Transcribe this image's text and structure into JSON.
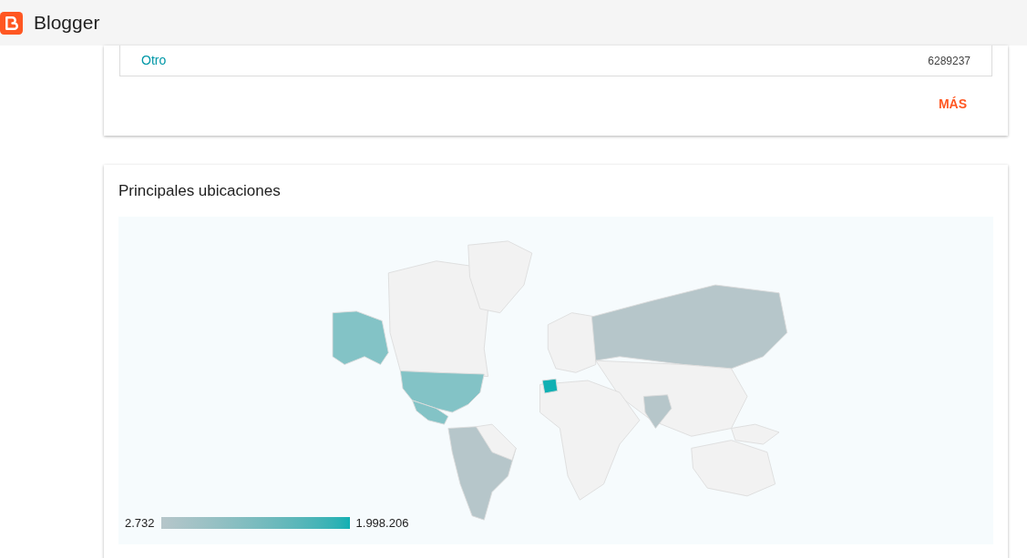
{
  "header": {
    "title": "Blogger"
  },
  "sources_card": {
    "rows": [
      {
        "label": "Otro",
        "count": "6289237"
      }
    ],
    "more_button": "MÁS"
  },
  "locations_card": {
    "title": "Principales ubicaciones",
    "legend": {
      "min": "2.732",
      "max": "1.998.206"
    }
  }
}
